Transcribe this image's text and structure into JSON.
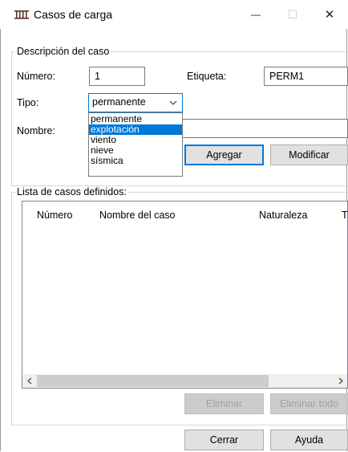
{
  "window": {
    "title": "Casos de carga",
    "minimize_glyph": "—",
    "maximize_glyph": "☐",
    "close_glyph": "✕"
  },
  "descripcion": {
    "legend": "Descripción del caso",
    "numero_label": "Número:",
    "numero_value": "1",
    "etiqueta_label": "Etiqueta:",
    "etiqueta_value": "PERM1",
    "tipo_label": "Tipo:",
    "tipo_value": "permanente",
    "tipo_options": [
      "permanente",
      "explotación",
      "viento",
      "nieve",
      "sísmica"
    ],
    "tipo_highlighted": "explotación",
    "nombre_label": "Nombre:",
    "nombre_value": "",
    "agregar_label": "Agregar",
    "modificar_label": "Modificar"
  },
  "lista": {
    "legend": "Lista de casos definidos:",
    "columns": [
      "Número",
      "Nombre del caso",
      "Naturaleza",
      "Ti"
    ],
    "eliminar_label": "Eliminar",
    "eliminar_todo_label": "Eliminar todo"
  },
  "footer": {
    "cerrar_label": "Cerrar",
    "ayuda_label": "Ayuda"
  }
}
